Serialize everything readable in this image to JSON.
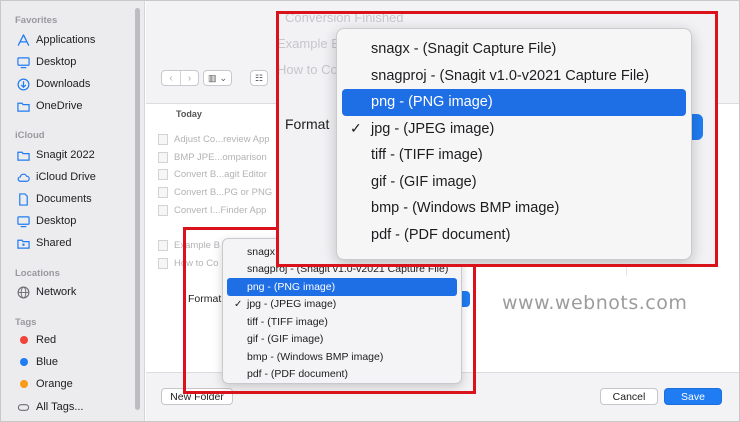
{
  "sidebar": {
    "sections": [
      {
        "label": "Favorites"
      },
      {
        "label": "iCloud"
      },
      {
        "label": "Locations"
      },
      {
        "label": "Tags"
      }
    ],
    "favorites": [
      {
        "label": "Applications",
        "icon": "applications-icon"
      },
      {
        "label": "Desktop",
        "icon": "desktop-icon"
      },
      {
        "label": "Downloads",
        "icon": "downloads-icon"
      },
      {
        "label": "OneDrive",
        "icon": "folder-icon"
      }
    ],
    "icloud": [
      {
        "label": "Snagit 2022",
        "icon": "folder-icon"
      },
      {
        "label": "iCloud Drive",
        "icon": "cloud-icon"
      },
      {
        "label": "Documents",
        "icon": "document-icon"
      },
      {
        "label": "Desktop",
        "icon": "desktop-icon"
      },
      {
        "label": "Shared",
        "icon": "shared-folder-icon"
      }
    ],
    "locations": [
      {
        "label": "Network",
        "icon": "network-globe-icon"
      }
    ],
    "tags": [
      {
        "label": "Red",
        "color": "#f0443a"
      },
      {
        "label": "Blue",
        "color": "#1f7cf2"
      },
      {
        "label": "Orange",
        "color": "#f79a18"
      },
      {
        "label": "All Tags...",
        "icon": "tag-outline-icon"
      }
    ]
  },
  "browser": {
    "group_header": "Today",
    "files": [
      "Adjust Co...review App",
      "BMP JPE...omparison",
      "Convert B...agit Editor",
      "Convert B...PG or PNG",
      "Convert I...Finder App"
    ],
    "ghost_files": [
      "Example B",
      "How to Co"
    ]
  },
  "footer": {
    "new_folder": "New Folder",
    "cancel": "Cancel",
    "save": "Save"
  },
  "format": {
    "label": "Format",
    "options": [
      {
        "label": "snagx - (Snagit Capture File)"
      },
      {
        "label": "snagproj - (Snagit v1.0-v2021 Capture File)"
      },
      {
        "label": "png - (PNG image)"
      },
      {
        "label": "jpg - (JPEG image)"
      },
      {
        "label": "tiff - (TIFF image)"
      },
      {
        "label": "gif - (GIF image)"
      },
      {
        "label": "bmp - (Windows BMP image)"
      },
      {
        "label": "pdf - (PDF document)"
      }
    ],
    "highlighted": "png - (PNG image)",
    "checked": "jpg - (JPEG image)"
  },
  "zoom_ghost": [
    "Conversion Finished",
    "Example B",
    "How to Co"
  ],
  "watermark": "www.webnots.com",
  "colors": {
    "accent": "#1f7cf2",
    "highlight_box": "#d9121b"
  }
}
